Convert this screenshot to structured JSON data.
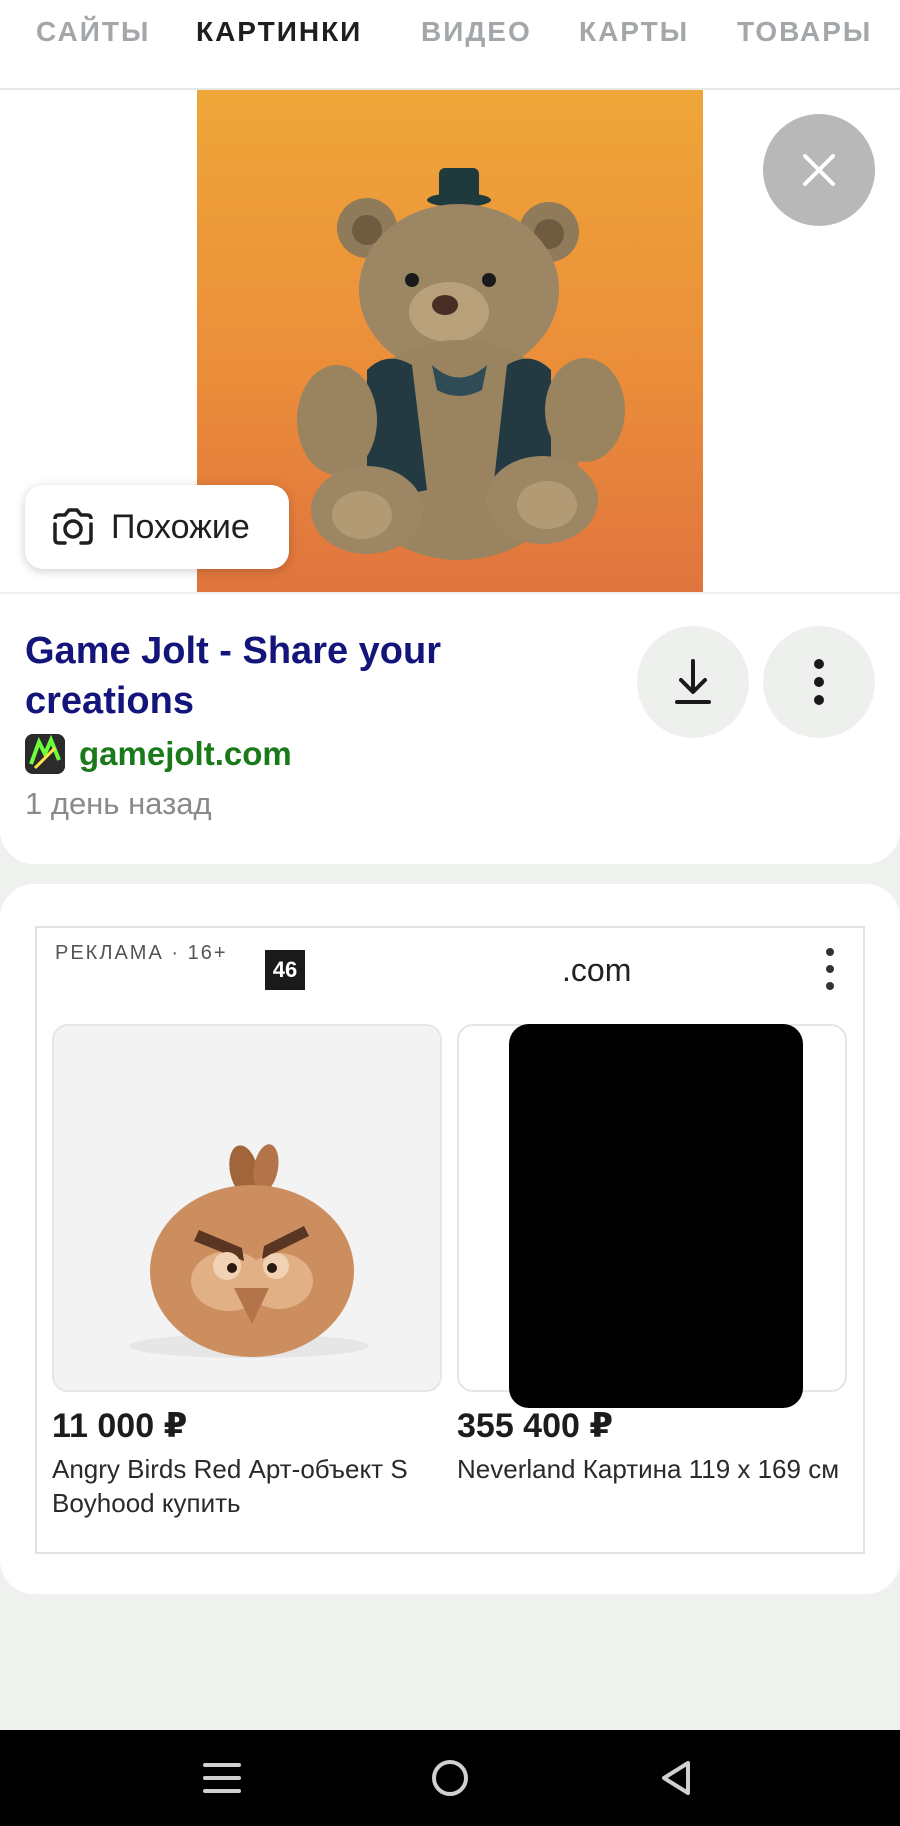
{
  "tabs": [
    {
      "label": "САЙТЫ",
      "active": false
    },
    {
      "label": "КАРТИНКИ",
      "active": true
    },
    {
      "label": "ВИДЕО",
      "active": false
    },
    {
      "label": "КАРТЫ",
      "active": false
    },
    {
      "label": "ТОВАРЫ",
      "active": false
    }
  ],
  "viewer": {
    "similar_label": "Похожие",
    "close_icon": "close-icon",
    "preview_background": "#eb8e3a"
  },
  "result": {
    "title": "Game Jolt - Share your creations",
    "site": "gamejolt.com",
    "posted": "1 день назад",
    "title_color": "#13157a",
    "site_color": "#1a7a1a"
  },
  "ad": {
    "label": "РЕКЛАМА · 16+",
    "logo_text": "46",
    "domain": ".com",
    "products": [
      {
        "price": "11 000 ₽",
        "name": "Angry Birds Red Арт-объект S Boyhood купить"
      },
      {
        "price": "355 400 ₽",
        "name": "Neverland Картина 119 x 169 см"
      }
    ]
  },
  "navbar": {
    "icons": [
      "menu-icon",
      "home-icon",
      "back-icon"
    ]
  }
}
